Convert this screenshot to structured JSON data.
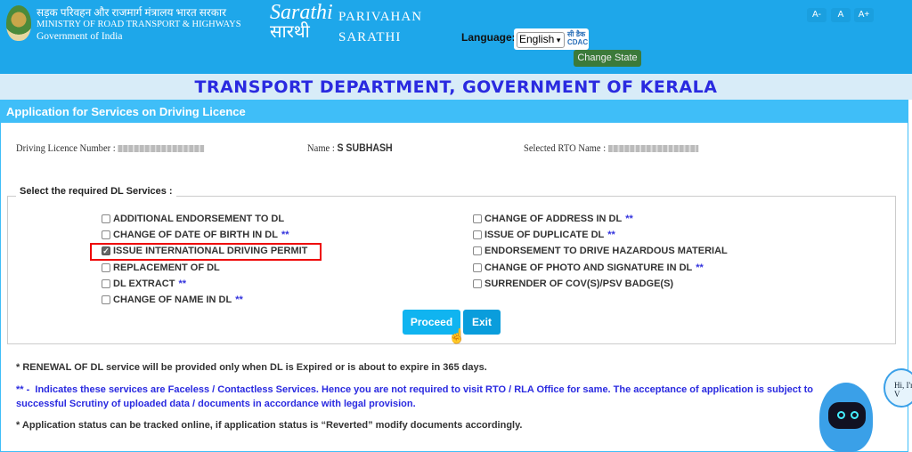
{
  "header": {
    "ministry_hindi": "सड़क परिवहन और राजमार्ग मंत्रालय भारत सरकार",
    "ministry": "MINISTRY OF ROAD TRANSPORT & HIGHWAYS",
    "government": "Government of India",
    "logo_text": "Sarathi",
    "logo_hindi": "सारथी",
    "brand_line1": "PARIVAHAN",
    "brand_line2": "SARATHI",
    "font_buttons": [
      "A-",
      "A",
      "A+"
    ],
    "language_label": "Language:",
    "language_value": "English",
    "cdac_hindi": "सी डैक",
    "cdac": "CDAC",
    "change_state": "Change State"
  },
  "title": "TRANSPORT DEPARTMENT, GOVERNMENT OF KERALA",
  "panel": {
    "heading": "Application for Services on Driving Licence",
    "dl_label": "Driving Licence Number :",
    "name_label": "Name :",
    "name_value": "S SUBHASH",
    "rto_label": "Selected RTO Name :",
    "legend": "Select the required DL Services :"
  },
  "services_left": [
    {
      "label": "ADDITIONAL ENDORSEMENT TO DL",
      "faceless": "",
      "checked": false
    },
    {
      "label": "CHANGE OF DATE OF BIRTH IN DL",
      "faceless": "**",
      "checked": false
    },
    {
      "label": "ISSUE INTERNATIONAL DRIVING PERMIT",
      "faceless": "",
      "checked": true
    },
    {
      "label": "REPLACEMENT OF DL",
      "faceless": "",
      "checked": false
    },
    {
      "label": "DL EXTRACT",
      "faceless": "**",
      "checked": false
    },
    {
      "label": "CHANGE OF NAME IN DL",
      "faceless": "**",
      "checked": false
    }
  ],
  "services_right": [
    {
      "label": "CHANGE OF ADDRESS IN DL",
      "faceless": "**",
      "checked": false
    },
    {
      "label": "ISSUE OF DUPLICATE DL",
      "faceless": "**",
      "checked": false
    },
    {
      "label": "ENDORSEMENT TO DRIVE HAZARDOUS MATERIAL",
      "faceless": "",
      "checked": false
    },
    {
      "label": "CHANGE OF PHOTO AND SIGNATURE IN DL",
      "faceless": "**",
      "checked": false
    },
    {
      "label": "SURRENDER OF COV(S)/PSV BADGE(S)",
      "faceless": "",
      "checked": false
    }
  ],
  "buttons": {
    "proceed": "Proceed",
    "exit": "Exit"
  },
  "notes": {
    "renewal": "* RENEWAL OF DL service will be provided only when DL is Expired or is about to expire in 365 days.",
    "faceless_prefix": "**  -",
    "faceless": "Indicates these services are Faceless / Contactless Services. Hence you are not required to visit RTO / RLA Office for same. The acceptance of application is subject to successful Scrutiny of uploaded data / documents in accordance with legal provision.",
    "status": "* Application status can be tracked online, if application status is “Reverted” modify documents accordingly."
  },
  "chatbot": {
    "greeting": "Hi, I'm V"
  },
  "colors": {
    "header": "#1ea7ea",
    "panel": "#3fbef8",
    "title": "#2a2ae0",
    "change_state": "#3b7a3a",
    "highlight": "#e00000"
  }
}
